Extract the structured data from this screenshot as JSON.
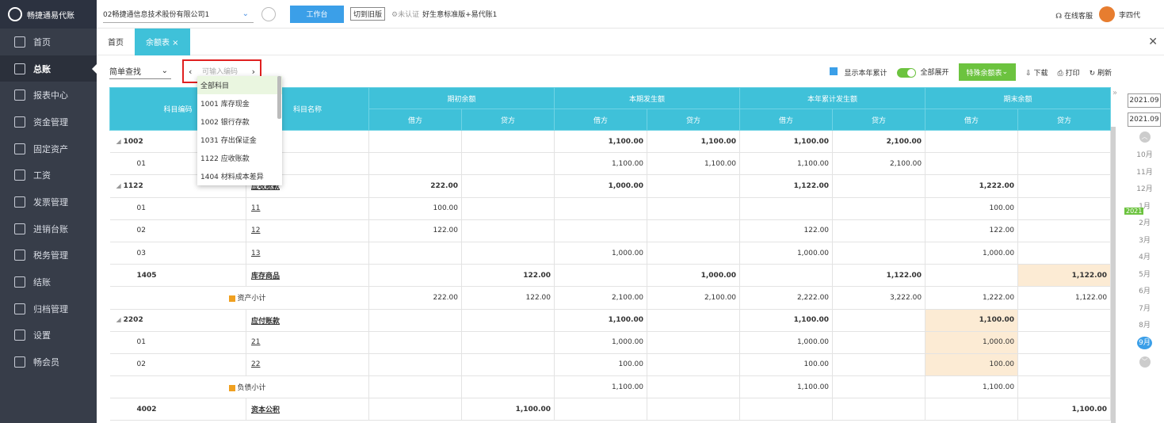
{
  "app": {
    "logo_text": "畅捷通易代账"
  },
  "sidebar": {
    "items": [
      {
        "label": "首页",
        "icon": "home-icon"
      },
      {
        "label": "总账",
        "icon": "ledger-icon",
        "active": true
      },
      {
        "label": "报表中心",
        "icon": "chart-icon"
      },
      {
        "label": "资金管理",
        "icon": "money-icon"
      },
      {
        "label": "固定资产",
        "icon": "asset-icon"
      },
      {
        "label": "工资",
        "icon": "salary-icon"
      },
      {
        "label": "发票管理",
        "icon": "invoice-icon"
      },
      {
        "label": "进销台账",
        "icon": "stock-icon"
      },
      {
        "label": "税务管理",
        "icon": "tax-icon"
      },
      {
        "label": "结账",
        "icon": "close-book-icon"
      },
      {
        "label": "归档管理",
        "icon": "archive-icon"
      },
      {
        "label": "设置",
        "icon": "gear-icon"
      },
      {
        "label": "畅会员",
        "icon": "vip-icon"
      }
    ]
  },
  "header": {
    "company": "02畅捷通信息技术股份有限公司1",
    "workbench": "工作台",
    "old_version": "切到旧版",
    "auth": "未认证",
    "product": "好生意标准版+易代账1",
    "service": "在线客服",
    "user": "李四代"
  },
  "tabs": [
    {
      "label": "首页"
    },
    {
      "label": "余额表 ×",
      "active": true
    }
  ],
  "toolbar": {
    "find_mode": "简单查找",
    "code_placeholder": "可输入编码",
    "show_year": "显示本年累计",
    "expand_all": "全部展开",
    "special": "特殊余额表",
    "download": "下载",
    "print": "打印",
    "refresh": "刷新"
  },
  "dropdown": [
    "全部科目",
    "1001 库存现金",
    "1002 银行存款",
    "1031 存出保证金",
    "1122 应收账款",
    "1404 材料成本差异"
  ],
  "table": {
    "head1": [
      "科目编码",
      "科目名称",
      "期初余额",
      "本期发生额",
      "本年累计发生额",
      "期末余额"
    ],
    "head2": [
      "借方",
      "贷方",
      "借方",
      "贷方",
      "借方",
      "贷方",
      "借方",
      "贷方"
    ],
    "rows": [
      {
        "code": "1002",
        "name": "",
        "v": [
          "",
          "",
          "1,100.00",
          "1,100.00",
          "1,100.00",
          "2,100.00",
          "",
          ""
        ],
        "bold": true,
        "tree": true
      },
      {
        "code": "01",
        "name": "",
        "v": [
          "",
          "",
          "1,100.00",
          "1,100.00",
          "1,100.00",
          "2,100.00",
          "",
          ""
        ]
      },
      {
        "code": "1122",
        "name": "应收账款",
        "v": [
          "222.00",
          "",
          "1,000.00",
          "",
          "1,122.00",
          "",
          "1,222.00",
          ""
        ],
        "bold": true,
        "tree": true
      },
      {
        "code": "01",
        "name": "11",
        "v": [
          "100.00",
          "",
          "",
          "",
          "",
          "",
          "100.00",
          ""
        ]
      },
      {
        "code": "02",
        "name": "12",
        "v": [
          "122.00",
          "",
          "",
          "",
          "122.00",
          "",
          "122.00",
          ""
        ]
      },
      {
        "code": "03",
        "name": "13",
        "v": [
          "",
          "",
          "1,000.00",
          "",
          "1,000.00",
          "",
          "1,000.00",
          ""
        ]
      },
      {
        "code": "1405",
        "name": "库存商品",
        "v": [
          "",
          "122.00",
          "",
          "1,000.00",
          "",
          "1,122.00",
          "",
          "1,122.00"
        ],
        "bold": true,
        "hl": [
          7
        ]
      },
      {
        "sub": "资产小计",
        "v": [
          "222.00",
          "122.00",
          "2,100.00",
          "2,100.00",
          "2,222.00",
          "3,222.00",
          "1,222.00",
          "1,122.00"
        ]
      },
      {
        "code": "2202",
        "name": "应付账款",
        "v": [
          "",
          "",
          "1,100.00",
          "",
          "1,100.00",
          "",
          "1,100.00",
          ""
        ],
        "bold": true,
        "tree": true,
        "hl": [
          6
        ]
      },
      {
        "code": "01",
        "name": "21",
        "v": [
          "",
          "",
          "1,000.00",
          "",
          "1,000.00",
          "",
          "1,000.00",
          ""
        ],
        "hl": [
          6
        ]
      },
      {
        "code": "02",
        "name": "22",
        "v": [
          "",
          "",
          "100.00",
          "",
          "100.00",
          "",
          "100.00",
          ""
        ],
        "hl": [
          6
        ]
      },
      {
        "sub": "负债小计",
        "v": [
          "",
          "",
          "1,100.00",
          "",
          "1,100.00",
          "",
          "1,100.00",
          ""
        ]
      },
      {
        "code": "4002",
        "name": "资本公积",
        "v": [
          "",
          "1,100.00",
          "",
          "",
          "",
          "",
          "",
          "1,100.00"
        ],
        "bold": true
      }
    ]
  },
  "period": {
    "start": "2021.09",
    "end": "2021.09",
    "year_tag": "2021",
    "months": [
      "10月",
      "11月",
      "12月",
      "1月",
      "2月",
      "3月",
      "4月",
      "5月",
      "6月",
      "7月",
      "8月",
      "9月"
    ],
    "current": "9月"
  }
}
